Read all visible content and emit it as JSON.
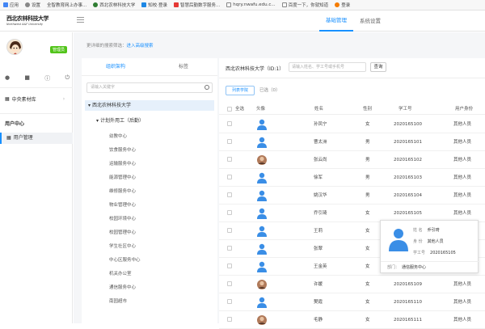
{
  "bookmarks": [
    "应用",
    "设置",
    "全智教育网上办事...",
    "西北农林科技大学",
    "知校·登录",
    "智慧后勤数字服务...",
    "hqry.nwafu.edu.c...",
    "百度一下，你就知道",
    "登录"
  ],
  "header": {
    "logo_cn": "西北农林科技大学",
    "logo_en": "Northwest A&F University",
    "nav": [
      "基础管理",
      "系统设置"
    ]
  },
  "sidebar": {
    "role_badge": "管理员",
    "menu_material": "中央素材库",
    "section_user": "用户中心",
    "item_user_mgmt": "用户管理"
  },
  "breadcrumb": {
    "text": "更详细的搜索筛选：",
    "link": "进入高级搜索"
  },
  "tree": {
    "tabs": [
      "组织架构",
      "标签"
    ],
    "search_placeholder": "请输入关键字",
    "root": "西北农林科技大学",
    "group": "计划外用工（后勤）",
    "leaves": [
      "幼教中心",
      "饮食服务中心",
      "运输服务中心",
      "能源管理中心",
      "维修服务中心",
      "物业管理中心",
      "校园环境中心",
      "校园管理中心",
      "学生社区中心",
      "中心区服务中心",
      "机关办公室",
      "通信服务中心",
      "南园超市"
    ]
  },
  "users": {
    "org_label": "西北农林科技大学（ID:1）",
    "search_placeholder": "请输入姓名、学工号或手机号",
    "search_button": "查询",
    "list_button": "列表学院",
    "selected_text": "已选（0）",
    "columns": [
      "全选",
      "头像",
      "姓名",
      "性别",
      "学工号",
      "用户身份"
    ],
    "rows": [
      {
        "name": "孙凤宁",
        "gender": "女",
        "id": "2020165100",
        "role": "其他人员",
        "avatar": "default"
      },
      {
        "name": "曹太洲",
        "gender": "男",
        "id": "2020165101",
        "role": "其他人员",
        "avatar": "default"
      },
      {
        "name": "张云尚",
        "gender": "男",
        "id": "2020165102",
        "role": "其他人员",
        "avatar": "photo"
      },
      {
        "name": "徐军",
        "gender": "男",
        "id": "2020165103",
        "role": "其他人员",
        "avatar": "default"
      },
      {
        "name": "姚汉华",
        "gender": "男",
        "id": "2020165104",
        "role": "其他人员",
        "avatar": "default"
      },
      {
        "name": "乔引琦",
        "gender": "女",
        "id": "2020165105",
        "role": "其他人员",
        "avatar": "default"
      },
      {
        "name": "王莉",
        "gender": "女",
        "id": "",
        "role": "",
        "avatar": "default"
      },
      {
        "name": "张翠",
        "gender": "女",
        "id": "",
        "role": "",
        "avatar": "default"
      },
      {
        "name": "王金英",
        "gender": "女",
        "id": "",
        "role": "",
        "avatar": "default"
      },
      {
        "name": "许媛",
        "gender": "女",
        "id": "2020165109",
        "role": "其他人员",
        "avatar": "photo"
      },
      {
        "name": "樊霞",
        "gender": "女",
        "id": "2020165110",
        "role": "其他人员",
        "avatar": "default"
      },
      {
        "name": "毛静",
        "gender": "女",
        "id": "2020165111",
        "role": "其他人员",
        "avatar": "photo"
      }
    ]
  },
  "popup": {
    "name_label": "姓 名",
    "name": "乔引琦",
    "id_label": "身 份",
    "identity": "其他人员",
    "no_label": "学工号",
    "no": "2020165105",
    "dept_label": "部门：",
    "dept": "通信服务中心"
  },
  "colors": {
    "accent": "#1890ff",
    "badge": "#52c41a",
    "avatar_blue": "#3a8ee6"
  }
}
